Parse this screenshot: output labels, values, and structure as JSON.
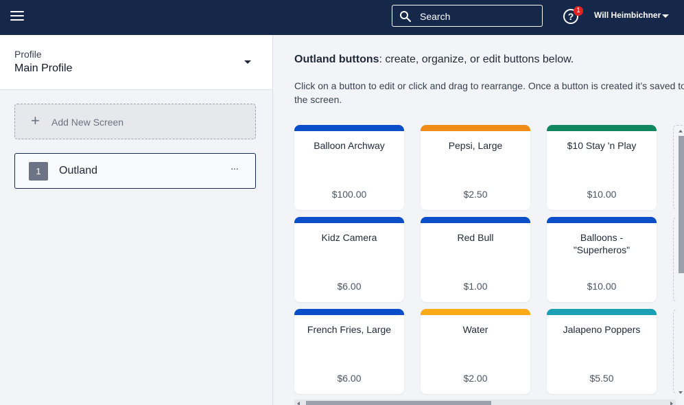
{
  "header": {
    "menu_icon": "hamburger-menu-icon",
    "search_label": "Search",
    "search_icon": "search-icon",
    "help_icon": "question-circle-icon",
    "notification_count": "1",
    "user_name": "Will Heimbichner"
  },
  "sidebar": {
    "profile_label": "Profile",
    "profile_name": "Main Profile",
    "add_screen_label": "Add New Screen",
    "screens": [
      {
        "number": "1",
        "name": "Outland",
        "more": "···"
      }
    ]
  },
  "main": {
    "heading_bold": "Outland buttons",
    "heading_rest": ": create, organize, or edit buttons below.",
    "description": "Click on a button to edit or click and drag to rearrange. Once a button is created it’s saved to the screen.",
    "buttons": [
      {
        "name": "Balloon Archway",
        "price": "$100.00",
        "color": "#0a4fc7"
      },
      {
        "name": "Pepsi, Large",
        "price": "$2.50",
        "color": "#f28c18"
      },
      {
        "name": "$10 Stay 'n Play",
        "price": "$10.00",
        "color": "#11865f"
      },
      {
        "name": "Kidz Camera",
        "price": "$6.00",
        "color": "#0a4fc7"
      },
      {
        "name": "Red Bull",
        "price": "$1.00",
        "color": "#0a4fc7"
      },
      {
        "name": "Balloons - \"Superheros\"",
        "price": "$10.00",
        "color": "#0a4fc7"
      },
      {
        "name": "French Fries, Large",
        "price": "$6.00",
        "color": "#0a4fc7"
      },
      {
        "name": "Water",
        "price": "$2.00",
        "color": "#fbab18"
      },
      {
        "name": "Jalapeno Poppers",
        "price": "$5.50",
        "color": "#1aa1b6"
      }
    ]
  },
  "colors": {
    "topbar": "#16284a",
    "accent_blue": "#0a4fc7"
  }
}
